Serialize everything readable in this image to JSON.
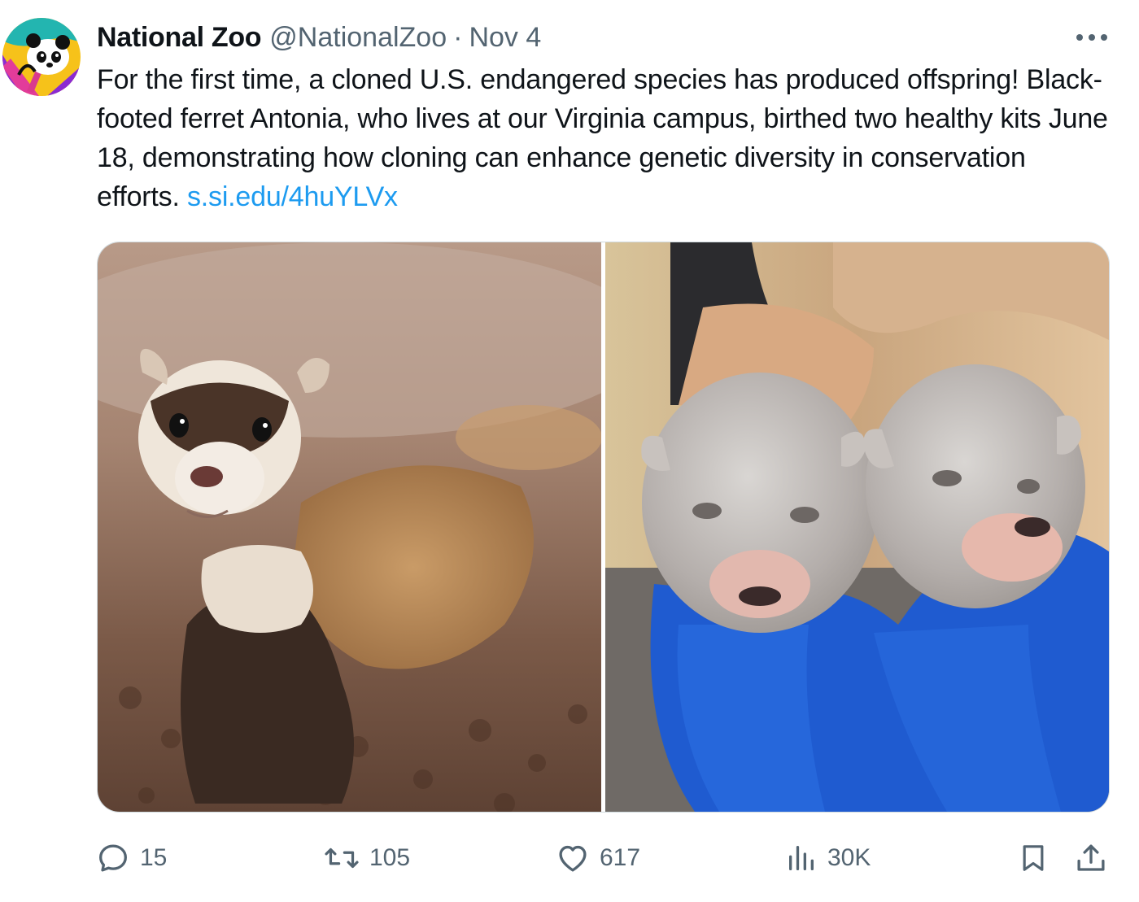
{
  "tweet": {
    "author": {
      "display_name": "National Zoo",
      "handle": "@NationalZoo",
      "separator": "·",
      "date": "Nov 4"
    },
    "text": "For the first time, a cloned U.S. endangered species has produced offspring! Black-footed ferret Antonia, who lives at our Virginia campus, birthed two healthy kits June 18, demonstrating how cloning can enhance genetic diversity in conservation efforts.",
    "link": "s.si.edu/4huYLVx",
    "media": [
      {
        "icon": "ferret-adult-photo"
      },
      {
        "icon": "ferret-kits-photo"
      }
    ]
  },
  "actions": {
    "replies": "15",
    "retweets": "105",
    "likes": "617",
    "views": "30K"
  },
  "colors": {
    "text": "#0f1419",
    "secondary": "#536471",
    "link": "#1d9bf0",
    "border": "#cfd9de"
  }
}
